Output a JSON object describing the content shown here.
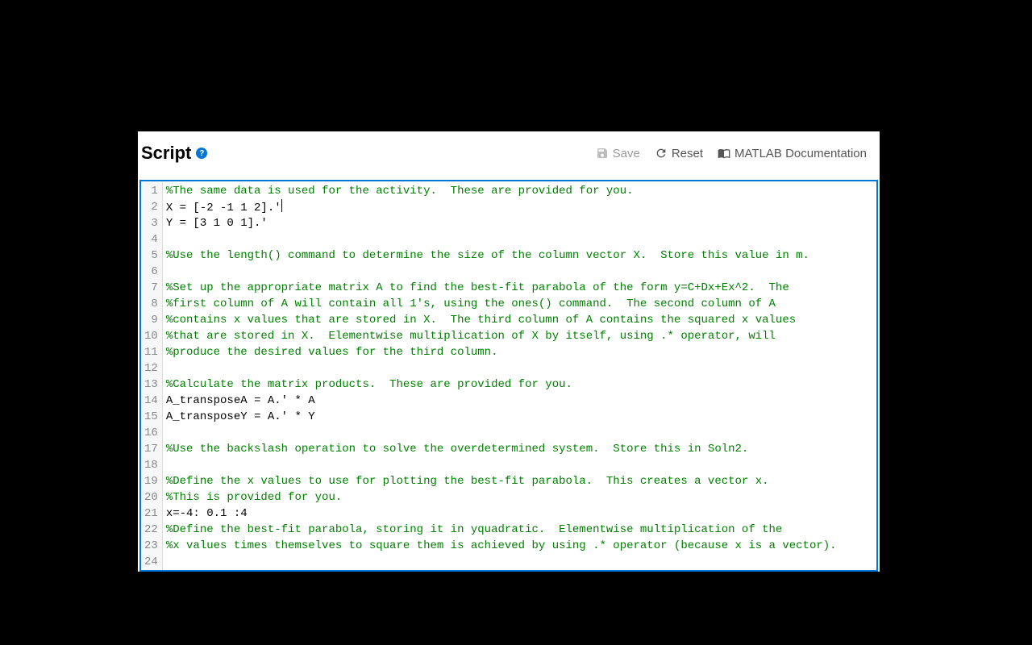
{
  "header": {
    "title": "Script",
    "help": "?",
    "save": "Save",
    "reset": "Reset",
    "docs": "MATLAB Documentation"
  },
  "lines": [
    {
      "n": "1",
      "type": "comment",
      "text": "%The same data is used for the activity.  These are provided for you."
    },
    {
      "n": "2",
      "type": "code",
      "text": "X = [-2 -1 1 2].'",
      "cursorAfter": true
    },
    {
      "n": "3",
      "type": "code",
      "text": "Y = [3 1 0 1].'"
    },
    {
      "n": "4",
      "type": "blank",
      "text": ""
    },
    {
      "n": "5",
      "type": "comment",
      "text": "%Use the length() command to determine the size of the column vector X.  Store this value in m."
    },
    {
      "n": "6",
      "type": "blank",
      "text": ""
    },
    {
      "n": "7",
      "type": "comment",
      "text": "%Set up the appropriate matrix A to find the best-fit parabola of the form y=C+Dx+Ex^2.  The"
    },
    {
      "n": "8",
      "type": "comment",
      "text": "%first column of A will contain all 1's, using the ones() command.  The second column of A"
    },
    {
      "n": "9",
      "type": "comment",
      "text": "%contains x values that are stored in X.  The third column of A contains the squared x values"
    },
    {
      "n": "10",
      "type": "comment",
      "text": "%that are stored in X.  Elementwise multiplication of X by itself, using .* operator, will"
    },
    {
      "n": "11",
      "type": "comment",
      "text": "%produce the desired values for the third column."
    },
    {
      "n": "12",
      "type": "blank",
      "text": ""
    },
    {
      "n": "13",
      "type": "comment",
      "text": "%Calculate the matrix products.  These are provided for you."
    },
    {
      "n": "14",
      "type": "code",
      "text": "A_transposeA = A.' * A"
    },
    {
      "n": "15",
      "type": "code",
      "text": "A_transposeY = A.' * Y"
    },
    {
      "n": "16",
      "type": "blank",
      "text": ""
    },
    {
      "n": "17",
      "type": "comment",
      "text": "%Use the backslash operation to solve the overdetermined system.  Store this in Soln2."
    },
    {
      "n": "18",
      "type": "blank",
      "text": ""
    },
    {
      "n": "19",
      "type": "comment",
      "text": "%Define the x values to use for plotting the best-fit parabola.  This creates a vector x."
    },
    {
      "n": "20",
      "type": "comment",
      "text": "%This is provided for you."
    },
    {
      "n": "21",
      "type": "code",
      "text": "x=-4: 0.1 :4"
    },
    {
      "n": "22",
      "type": "comment",
      "text": "%Define the best-fit parabola, storing it in yquadratic.  Elementwise multiplication of the"
    },
    {
      "n": "23",
      "type": "comment",
      "text": "%x values times themselves to square them is achieved by using .* operator (because x is a vector)."
    },
    {
      "n": "24",
      "type": "blank",
      "text": ""
    }
  ]
}
